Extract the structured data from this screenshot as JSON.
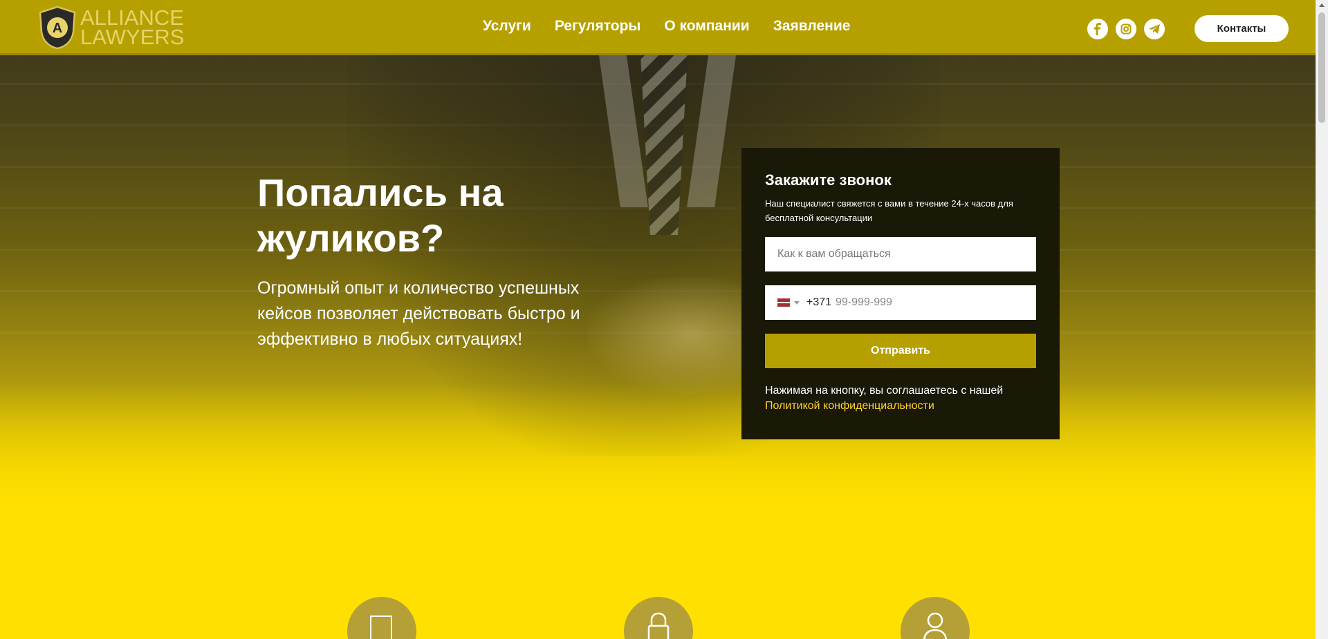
{
  "header": {
    "logo": {
      "line1": "ALLIANCE",
      "line2": "LAWYERS"
    },
    "nav": [
      {
        "label": "Услуги"
      },
      {
        "label": "Регуляторы"
      },
      {
        "label": "О компании"
      },
      {
        "label": "Заявление"
      }
    ],
    "social": [
      {
        "icon": "facebook-icon"
      },
      {
        "icon": "instagram-icon"
      },
      {
        "icon": "telegram-icon"
      }
    ],
    "contacts_label": "Контакты"
  },
  "hero": {
    "title": "Попались на жуликов?",
    "subtitle": "Огромный опыт и количество успешных кейсов позволяет действовать быстро и эффективно в любых ситуациях!"
  },
  "form": {
    "title": "Закажите звонок",
    "description": "Наш специалист свяжется с вами в течение 24-х часов для бесплатной консультации",
    "name_placeholder": "Как к вам обращаться",
    "phone_code": "+371",
    "phone_placeholder": "99-999-999",
    "submit_label": "Отправить",
    "consent_text": "Нажимая на кнопку, вы соглашаетесь с нашей",
    "consent_link": "Политикой конфиденциальности"
  },
  "features": [
    {
      "icon": "document-icon"
    },
    {
      "icon": "lock-icon"
    },
    {
      "icon": "user-icon"
    }
  ],
  "colors": {
    "header_bg": "#b6a000",
    "accent": "#ffe000",
    "panel_bg": "#1a1807",
    "link": "#ffd52a"
  }
}
